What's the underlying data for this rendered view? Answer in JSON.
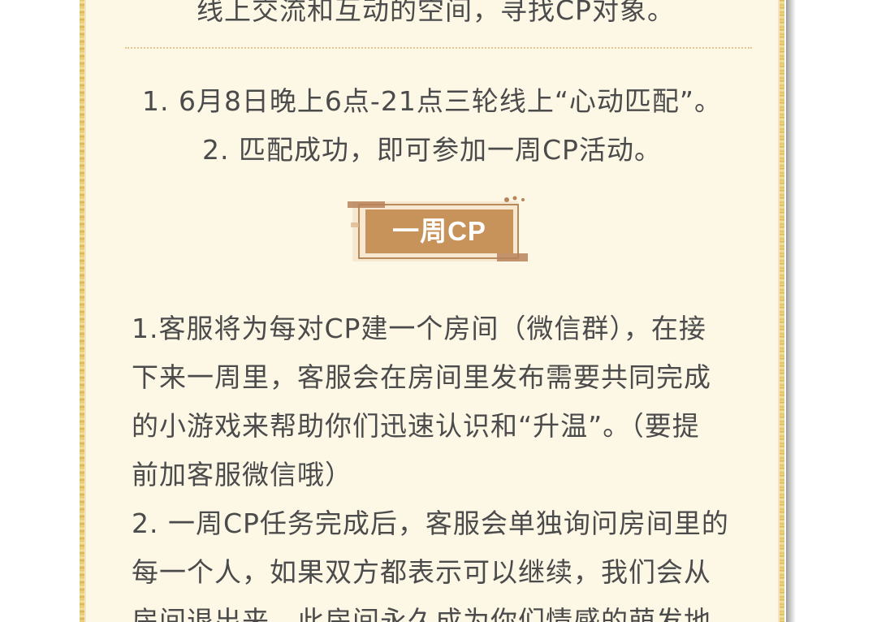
{
  "top_line": "线上交流和互动的空间，寻找CP对象。",
  "rules": {
    "line1": "1. 6月8日晚上6点-21点三轮线上“心动匹配”。",
    "line2": "2. 匹配成功，即可参加一周CP活动。"
  },
  "section": {
    "title": "一周CP"
  },
  "details": [
    "1.客服将为每对CP建一个房间（微信群），在接",
    "下来一周里，客服会在房间里发布需要共同完成",
    "的小游戏来帮助你们迅速认识和“升温”。（要提",
    "前加客服微信哦）",
    "2. 一周CP任务完成后，客服会单独询问房间里的",
    "每一个人，如果双方都表示可以继续，我们会从",
    "房间退出来，此房间永久成为你们情感的萌发地"
  ],
  "colors": {
    "panel": "#fdf7e6",
    "gold": "#e3c46a",
    "badge": "#c7935a",
    "text": "#4b4b4b"
  }
}
